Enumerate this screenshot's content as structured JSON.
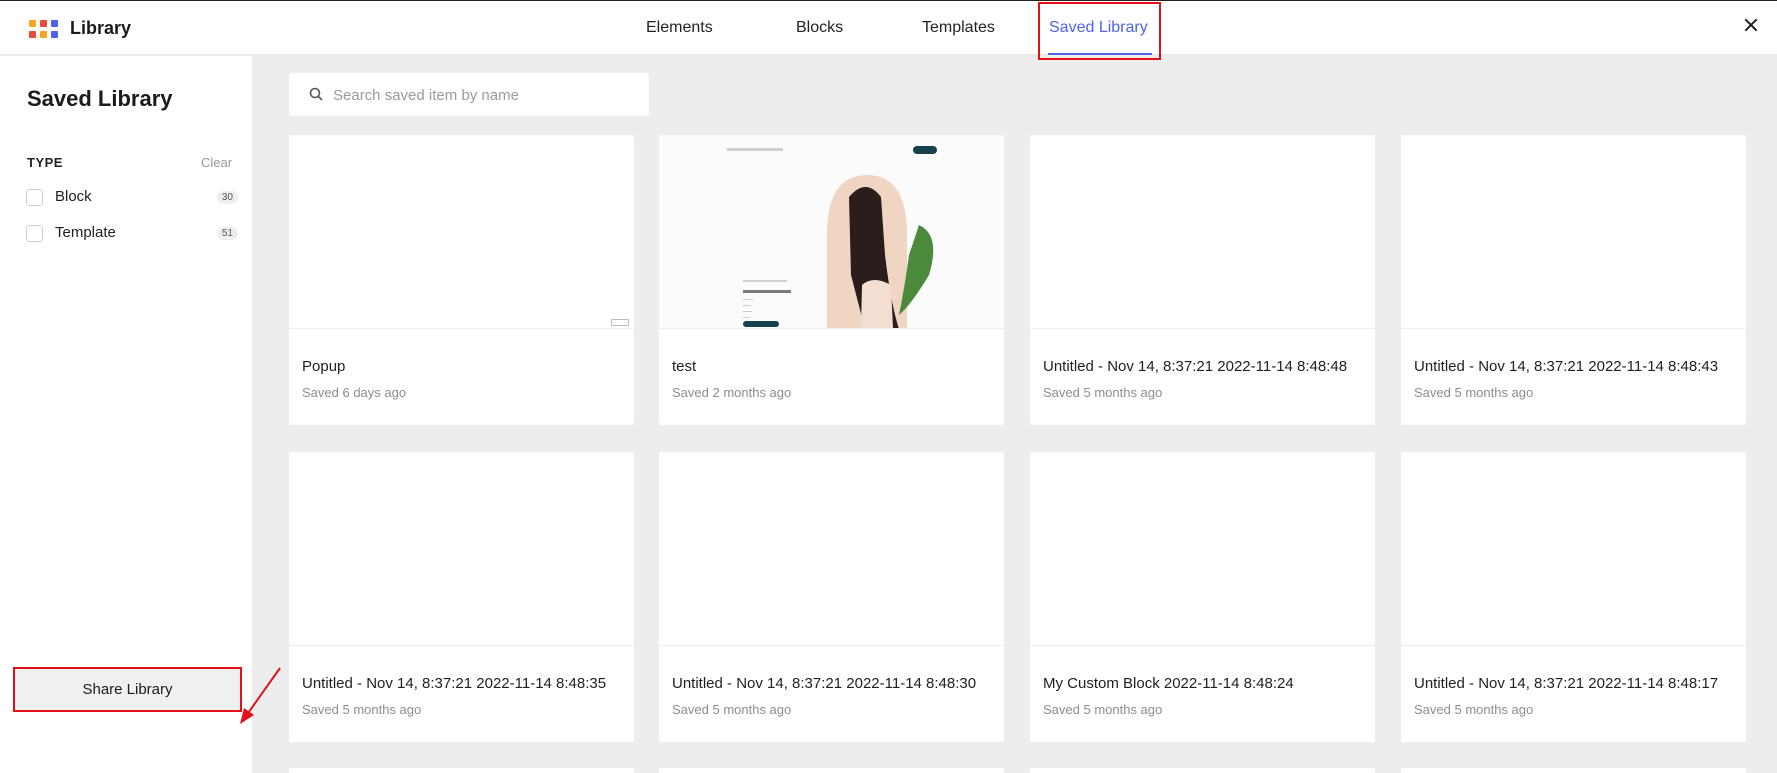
{
  "app": {
    "title": "Library"
  },
  "colors": {
    "accent": "#4f63e8",
    "highlight": "#e3101a",
    "logo": [
      "#f5a623",
      "#e94b3c",
      "#4f63e8",
      "#e94b3c",
      "#f5a623",
      "#4f63e8"
    ]
  },
  "tabs": [
    {
      "label": "Elements",
      "active": false
    },
    {
      "label": "Blocks",
      "active": false
    },
    {
      "label": "Templates",
      "active": false
    },
    {
      "label": "Saved Library",
      "active": true
    }
  ],
  "sidebar": {
    "title": "Saved Library",
    "type_label": "TYPE",
    "clear_label": "Clear",
    "filters": [
      {
        "label": "Block",
        "count": "30"
      },
      {
        "label": "Template",
        "count": "51"
      }
    ],
    "share_label": "Share Library"
  },
  "search": {
    "placeholder": "Search saved item by name",
    "value": ""
  },
  "cards": [
    {
      "name": "Popup",
      "saved": "Saved 6 days ago"
    },
    {
      "name": "test",
      "saved": "Saved 2 months ago"
    },
    {
      "name": "Untitled - Nov 14, 8:37:21 2022-11-14 8:48:48",
      "saved": "Saved 5 months ago"
    },
    {
      "name": "Untitled - Nov 14, 8:37:21 2022-11-14 8:48:43",
      "saved": "Saved 5 months ago"
    },
    {
      "name": "Untitled - Nov 14, 8:37:21 2022-11-14 8:48:35",
      "saved": "Saved 5 months ago"
    },
    {
      "name": "Untitled - Nov 14, 8:37:21 2022-11-14 8:48:30",
      "saved": "Saved 5 months ago"
    },
    {
      "name": "My Custom Block 2022-11-14 8:48:24",
      "saved": "Saved 5 months ago"
    },
    {
      "name": "Untitled - Nov 14, 8:37:21 2022-11-14 8:48:17",
      "saved": "Saved 5 months ago"
    }
  ]
}
